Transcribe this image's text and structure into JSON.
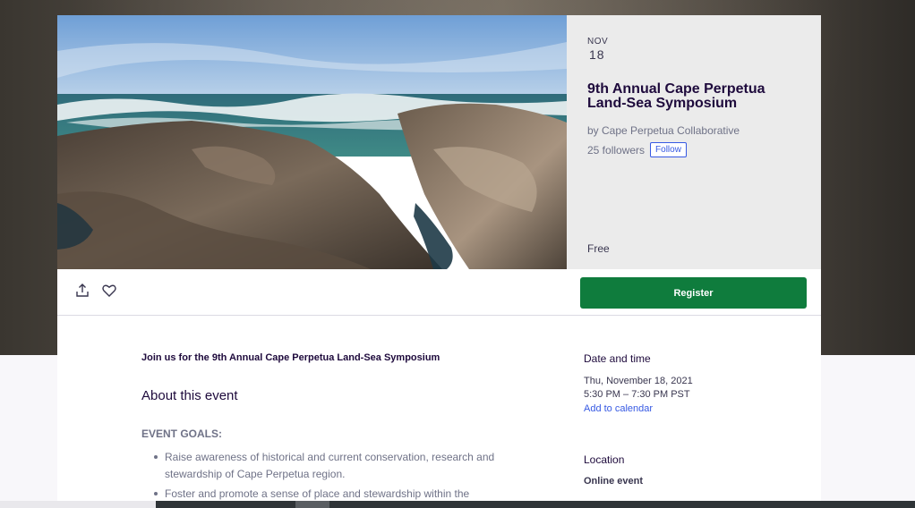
{
  "event": {
    "month": "NOV",
    "day": "18",
    "title": "9th Annual Cape Perpetua Land-Sea Symposium",
    "organizer": "by Cape Perpetua Collaborative",
    "followers": "25 followers",
    "follow_label": "Follow",
    "price": "Free",
    "hero_image": "rocky-coastline-photo"
  },
  "actions": {
    "share_icon": "share-icon",
    "like_icon": "heart-icon",
    "register_label": "Register"
  },
  "main": {
    "summary": "Join us for the 9th Annual Cape Perpetua Land-Sea Symposium",
    "about_heading": "About this event",
    "goals_heading": "EVENT GOALS:",
    "goals": [
      "Raise awareness of historical and current conservation, research and stewardship of Cape Perpetua region.",
      "Foster and promote a sense of place and stewardship within the"
    ]
  },
  "sidebar": {
    "datetime_heading": "Date and time",
    "date": "Thu, November 18, 2021",
    "time": "5:30 PM – 7:30 PM PST",
    "calendar_link": "Add to calendar",
    "location_heading": "Location",
    "location_value": "Online event"
  },
  "colors": {
    "register_green": "#0f7c3d",
    "link_blue": "#3659e3",
    "title_text": "#1e0a3c",
    "muted_text": "#6f7287"
  }
}
